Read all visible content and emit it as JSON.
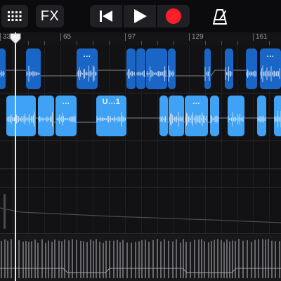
{
  "toolbar": {
    "fx_label": "FX",
    "icons": [
      "grid-menu-icon",
      "rewind-icon",
      "play-icon",
      "record-icon",
      "metronome-icon"
    ],
    "record_color": "#ff1f2a"
  },
  "ruler": {
    "bar_numbers": [
      "33",
      "65",
      "97",
      "129",
      "161"
    ]
  },
  "regions": {
    "track1_label_a": "...",
    "track1_label_b": "...",
    "track2_label_a": "...",
    "track2_label_b": "U...1",
    "track2_label_c": "..."
  },
  "colors": {
    "region_dark": "#1a66c6",
    "region_light": "#3fa2f5",
    "background": "#121214",
    "playhead": "#e8e8ea"
  }
}
